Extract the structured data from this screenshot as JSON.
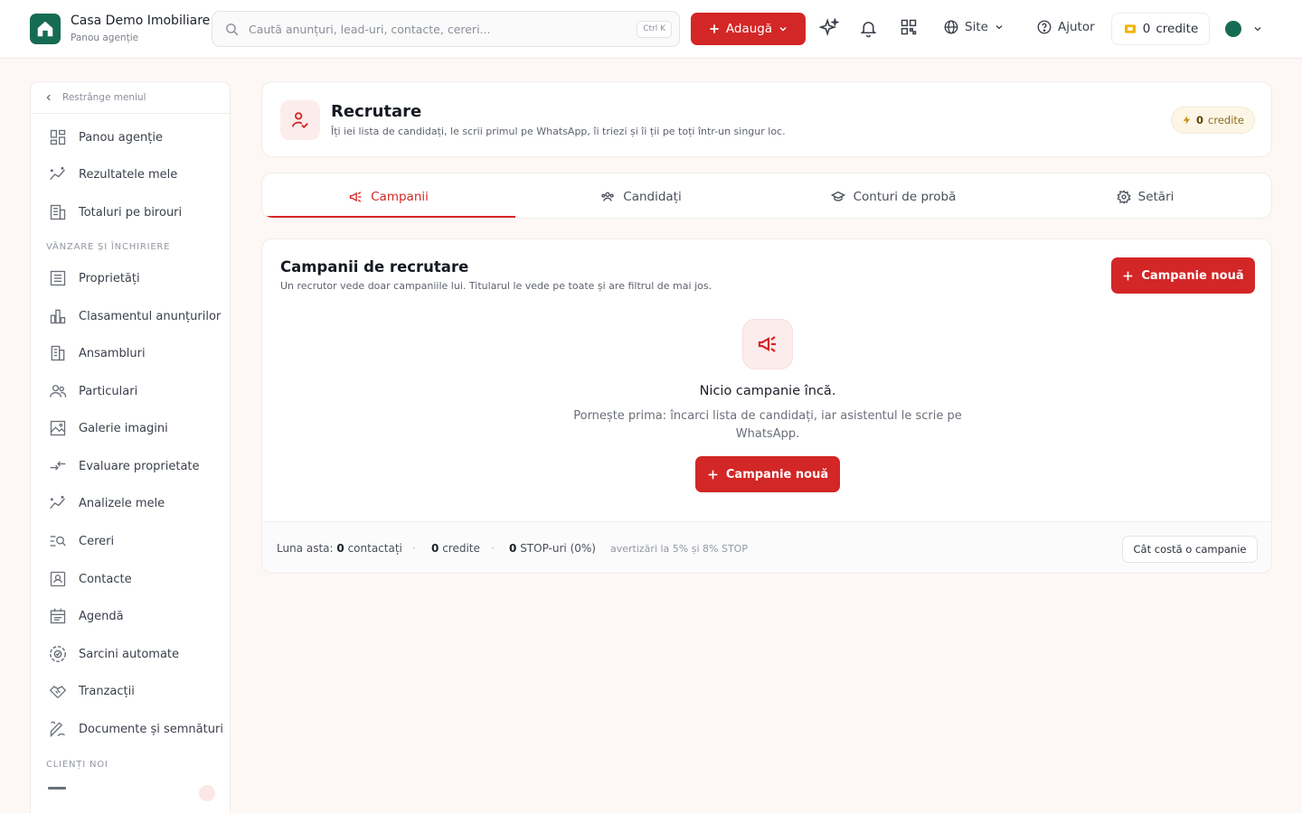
{
  "app": {
    "title": "Casa Demo Imobiliare",
    "subtitle": "Panou agenție",
    "brand_color": "#166b53",
    "accent_color": "#d32626"
  },
  "topbar": {
    "search_placeholder": "Caută anunțuri, lead-uri, contacte, cereri...",
    "search_shortcut": "Ctrl K",
    "add_label": "Adaugă",
    "site_label": "Site",
    "help_label": "Ajutor",
    "credits_count": "0",
    "credits_label": "credite",
    "icons": [
      "sparkle-icon",
      "bell-icon",
      "qr-code-icon",
      "globe-icon",
      "help-circle-icon",
      "wallet-icon",
      "avatar",
      "chevron-down-icon"
    ]
  },
  "sidebar": {
    "collapse_label": "Restrânge meniul",
    "items_top": [
      {
        "label": "Panou agenție",
        "icon": "dashboard-icon"
      },
      {
        "label": "Rezultatele mele",
        "icon": "chart-line-icon"
      },
      {
        "label": "Totaluri pe birouri",
        "icon": "building-icon"
      }
    ],
    "section_sales": "VÂNZARE ȘI ÎNCHIRIERE",
    "items_sales": [
      {
        "label": "Proprietăți",
        "icon": "list-icon"
      },
      {
        "label": "Clasamentul anunțurilor",
        "icon": "bar-chart-icon"
      },
      {
        "label": "Ansambluri",
        "icon": "buildings-icon"
      },
      {
        "label": "Particulari",
        "icon": "users-icon"
      },
      {
        "label": "Galerie imagini",
        "icon": "image-icon"
      },
      {
        "label": "Evaluare proprietate",
        "icon": "arrows-icon"
      },
      {
        "label": "Analizele mele",
        "icon": "chart-line-icon"
      },
      {
        "label": "Cereri",
        "icon": "search-list-icon"
      },
      {
        "label": "Contacte",
        "icon": "contact-card-icon"
      },
      {
        "label": "Agendă",
        "icon": "calendar-icon"
      },
      {
        "label": "Sarcini automate",
        "icon": "auto-task-icon"
      },
      {
        "label": "Tranzacții",
        "icon": "handshake-icon"
      },
      {
        "label": "Documente și semnături",
        "icon": "signature-icon"
      }
    ],
    "section_clients": "CLIENȚI NOI"
  },
  "header": {
    "title": "Recrutare",
    "subtitle": "Îți iei lista de candidați, le scrii primul pe WhatsApp, îi triezi și îi ții pe toți într-un singur loc.",
    "credits_count": "0",
    "credits_label": "credite"
  },
  "tabs": [
    {
      "label": "Campanii",
      "icon": "megaphone-icon",
      "active": true
    },
    {
      "label": "Candidați",
      "icon": "users-icon",
      "active": false
    },
    {
      "label": "Conturi de probă",
      "icon": "graduation-cap-icon",
      "active": false
    },
    {
      "label": "Setări",
      "icon": "gear-icon",
      "active": false
    }
  ],
  "campaigns": {
    "title": "Campanii de recrutare",
    "subtitle": "Un recrutor vede doar campaniile lui. Titularul le vede pe toate și are filtrul de mai jos.",
    "new_button": "Campanie nouă",
    "empty_title": "Nicio campanie încă.",
    "empty_desc": "Pornește prima: încarci lista de candidați, iar asistentul le scrie pe WhatsApp.",
    "empty_button": "Campanie nouă"
  },
  "footer": {
    "month_label": "Luna asta:",
    "contacted_count": "0",
    "contacted_label": "contactați",
    "credits_count": "0",
    "credits_label": "credite",
    "stop_count": "0",
    "stop_label": "STOP-uri (0%)",
    "warning": "avertizări la 5% și 8% STOP",
    "cost_button": "Cât costă o campanie"
  }
}
